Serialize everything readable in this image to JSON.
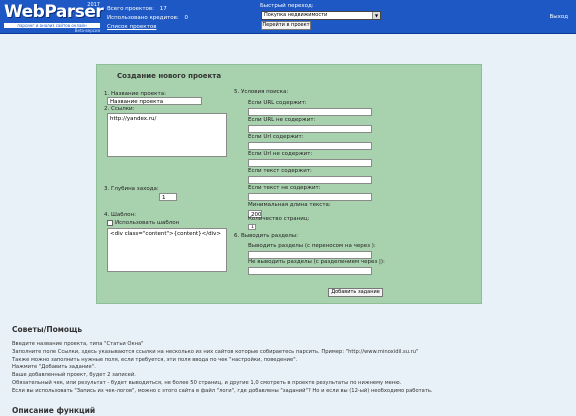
{
  "header": {
    "logo_text": "WebParser",
    "logo_year": "2017",
    "logo_tagline": "парсинг и анализ сайтов онлайн",
    "logo_version": "Beta-версия",
    "stats": {
      "projects_label": "Всего проектов:",
      "projects_value": "17",
      "results_label": "Использовано кредитов:",
      "results_value": "0",
      "projects_link": "Список проектов"
    },
    "quick_label": "Быстрый переход:",
    "quick_selected": "Покупка недвижимости",
    "quick_button": "Перейти в проект",
    "logout": "Выход"
  },
  "form": {
    "title": "Создание нового проекта",
    "name_label": "1. Название проекта:",
    "name_value": "Название проекта",
    "urls_label": "2. Ссылки:",
    "urls_value": "http://yandex.ru/",
    "depth_label": "3. Глубина захода:",
    "depth_value": "1",
    "extract_label": "4. Шаблон:",
    "extract_checkbox_label": "Использовать шаблон",
    "extract_value": "<div class=\"content\">{content}</div>",
    "conditions_label": "5. Условия поиска:",
    "cond_fields": [
      "Если URL содержит:",
      "Если URL не содержит:",
      "Если Url содержит:",
      "Если Url не содержит:",
      "Если текст содержит:",
      "Если текст не содержит:"
    ],
    "min_length_label": "Минимальная длина текста:",
    "min_length_value": "200",
    "max_pages_label": "Количество страниц:",
    "max_pages_value": "1",
    "extra_label": "6. Выводить разделы:",
    "separator_label": "Выводить разделы (с переносом на через ):",
    "separator2_label": "Не выводить разделы (с разделением через |):",
    "submit": "Добавить задание"
  },
  "tips": {
    "title": "Советы/Помощь",
    "lines": [
      "Введите название проекта, типа \"Статьи Окна\"",
      "Заполните поле Ссылки, здесь указываются ссылки на несколько из них сайтов которые собираетесь парсить. Пример: \"http://www.minoxidil.su.ru\"",
      "Также можно заполнить нужные поля, если требуется, эти поля ввода по чек \"настройки, поведение\".",
      "Нажмите \"Добавить задание\".",
      "Ваше добавленный проект, будет 2 записей.",
      "Обязательный чек, или результат - будет выводиться, не более 50 страниц, и другие 1,0 смотреть в проекте результаты по нижнему меню.",
      "Если вы использовать \"Запись из чек-логов\", можно с этого сайта в файл \"логи\", где добавлены \"заданий\"? Но и если вы (12-ый) необходимо работать."
    ]
  },
  "functions": {
    "title": "Описание функций"
  }
}
